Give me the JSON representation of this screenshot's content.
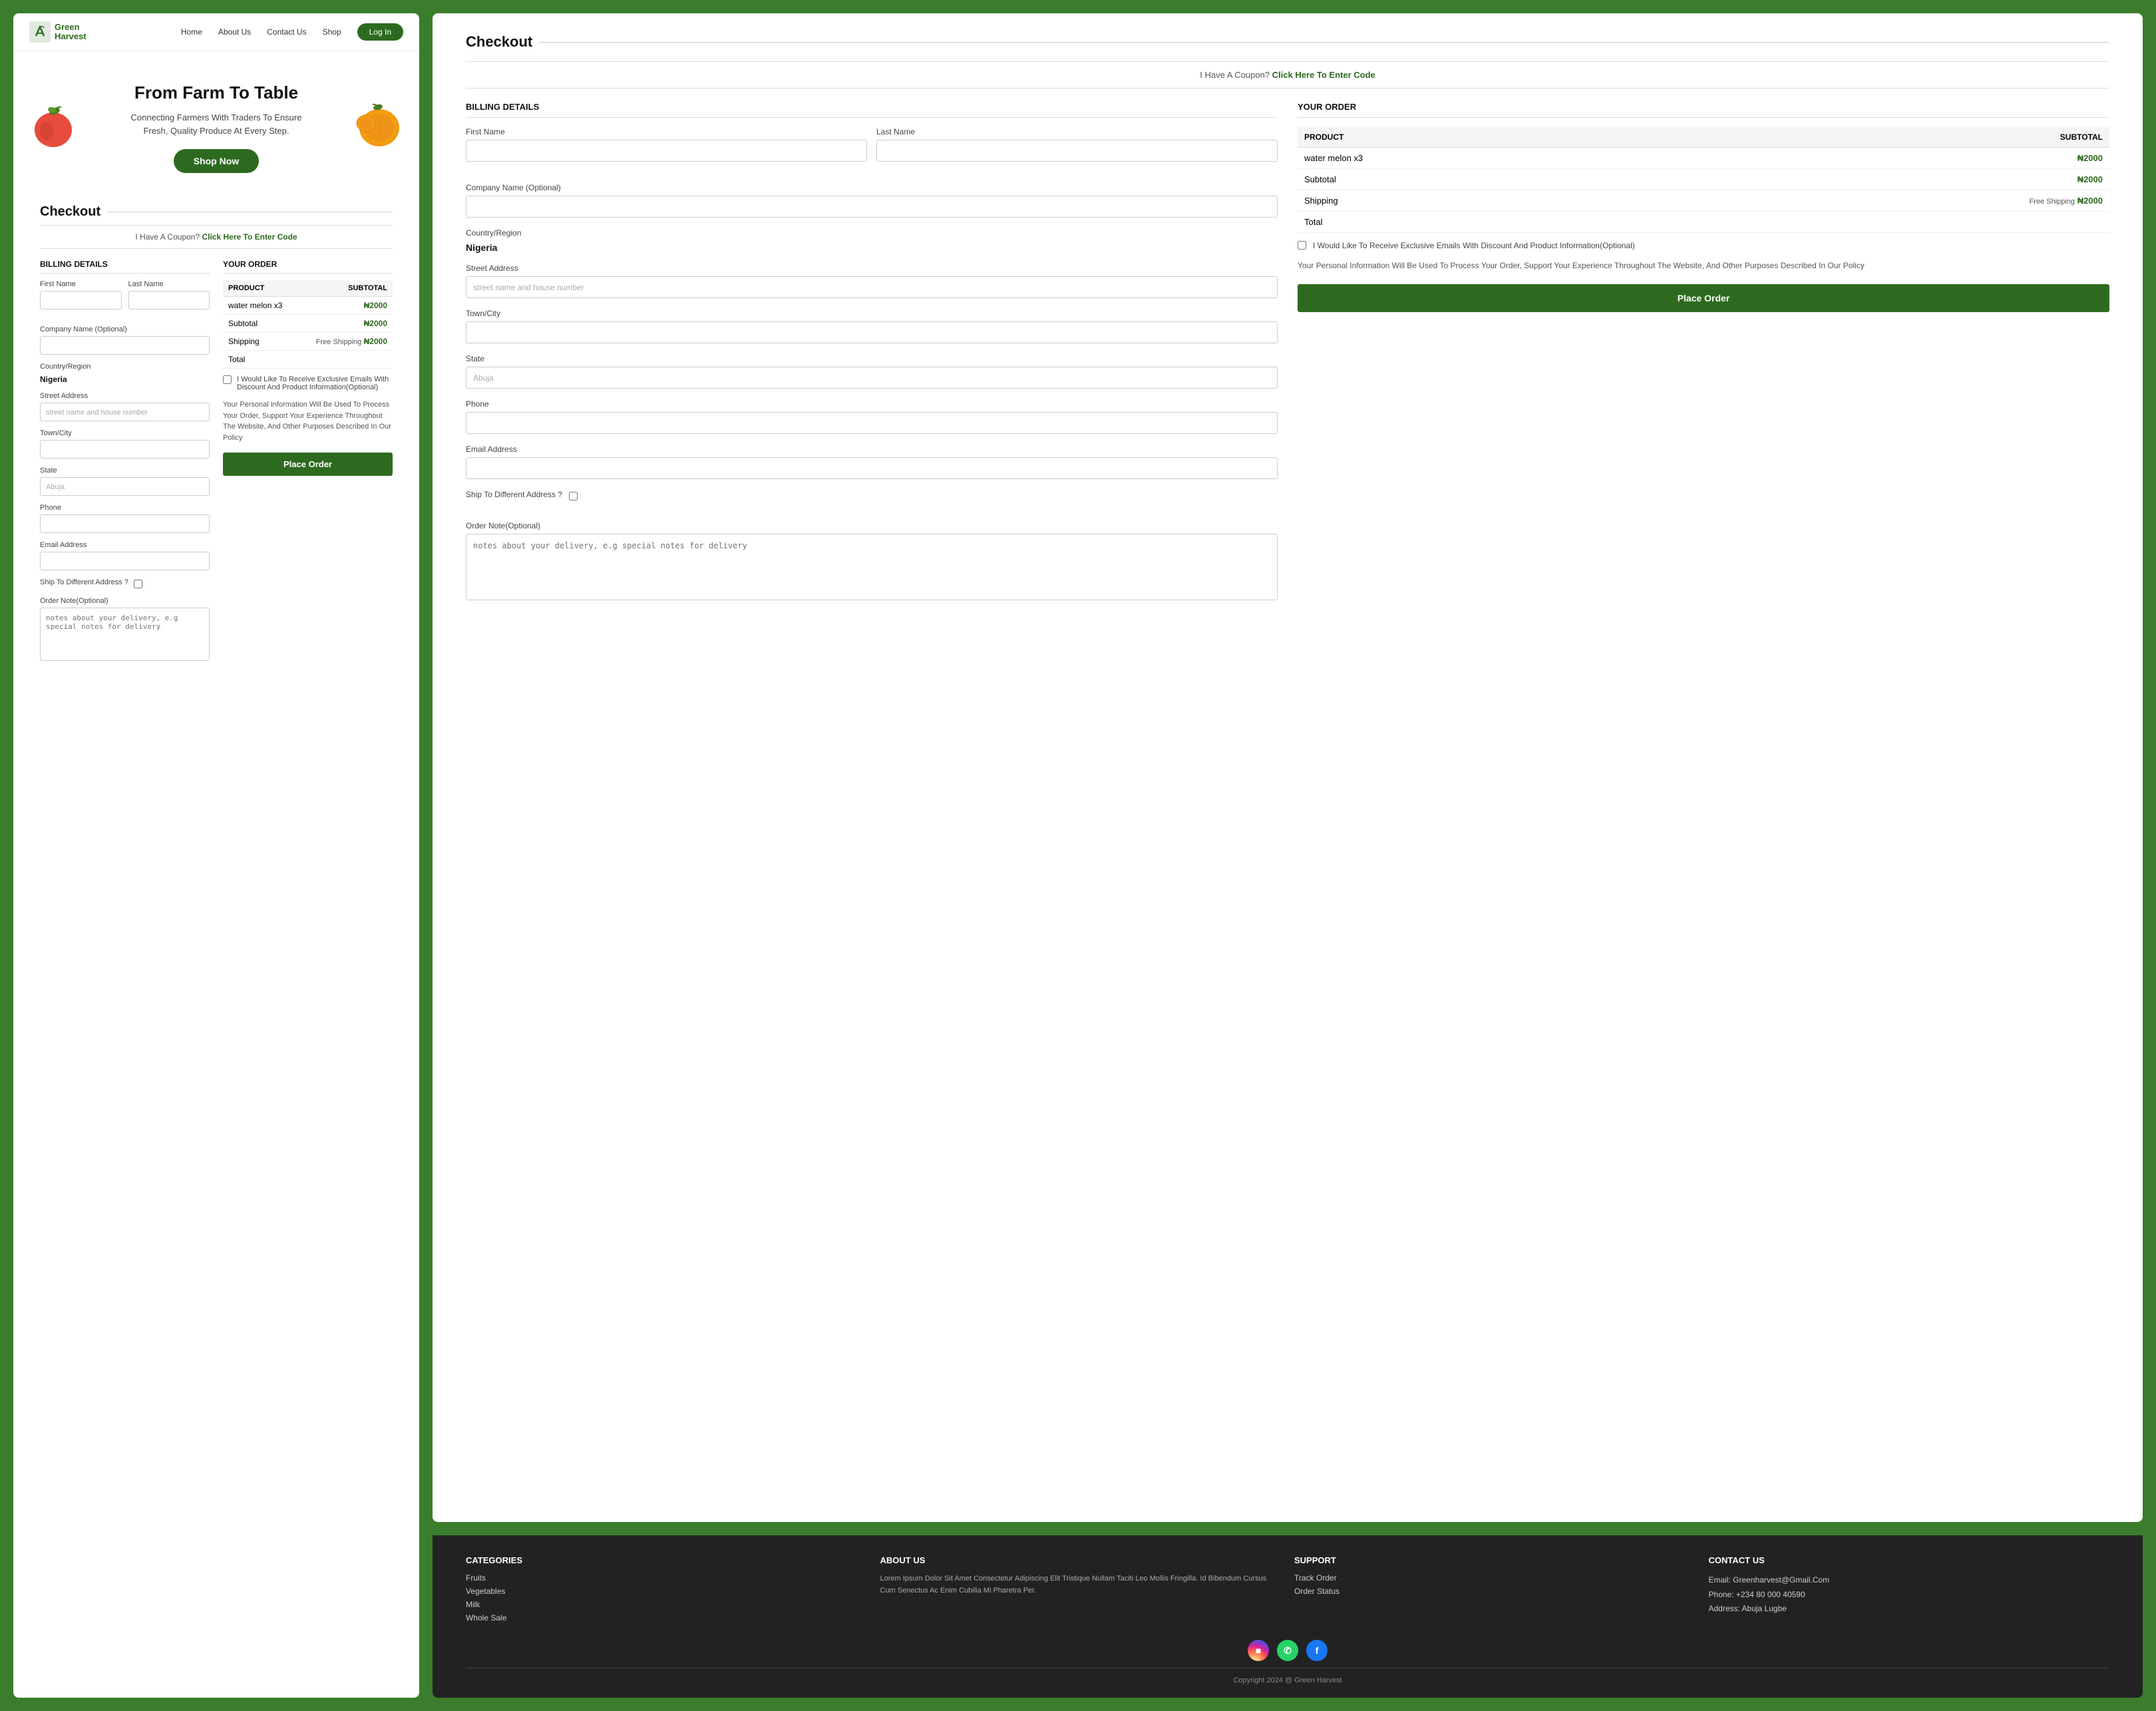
{
  "nav": {
    "logo_text_line1": "Green",
    "logo_text_line2": "Harvest",
    "links": [
      "Home",
      "About Us",
      "Contact Us",
      "Shop"
    ],
    "login_label": "Log In"
  },
  "hero": {
    "title": "From Farm To Table",
    "subtitle": "Connecting Farmers With Traders To Ensure\nFresh, Quality Produce At Every Step.",
    "shop_now": "Shop Now"
  },
  "checkout_left": {
    "title": "Checkout",
    "coupon_text": "I Have A Coupon?",
    "coupon_link": "Click Here To Enter Code",
    "billing_label": "BILLING DETAILS",
    "order_label": "YOUR ORDER",
    "first_name_label": "First Name",
    "last_name_label": "Last Name",
    "company_label": "Company Name (Optional)",
    "country_label": "Country/Region",
    "country_value": "Nigeria",
    "street_label": "Street Address",
    "street_placeholder": "street name and house number",
    "town_label": "Town/City",
    "state_label": "State",
    "state_value": "Abuja",
    "phone_label": "Phone",
    "email_label": "Email Address",
    "ship_label": "Ship To Different Address ?",
    "order_note_label": "Order Note(Optional)",
    "order_note_placeholder": "notes about your delivery, e.g special notes for delivery",
    "product_col": "PRODUCT",
    "subtotal_col": "SUBTOTAL",
    "product_row": "water melon x3",
    "product_price": "₦2000",
    "subtotal_row": "Subtotal",
    "subtotal_price": "₦2000",
    "shipping_row": "Shipping",
    "free_shipping": "Free Shipping",
    "shipping_price": "₦2000",
    "total_row": "Total",
    "email_checkbox": "I Would Like To Receive Exclusive Emails With Discount And Product Information(Optional)",
    "privacy_text": "Your Personal Information Will Be Used To Process Your Order, Support Your Experience Throughout The Website, And Other Purposes Described In Our Policy",
    "place_order": "Place Order"
  },
  "checkout_right": {
    "title": "Checkout",
    "coupon_text": "I Have A Coupon?",
    "coupon_link": "Click Here To Enter Code",
    "billing_label": "BILLING DETAILS",
    "order_label": "YOUR ORDER",
    "first_name_label": "First Name",
    "last_name_label": "Last Name",
    "company_label": "Company Name (Optional)",
    "country_label": "Country/Region",
    "country_value": "Nigeria",
    "street_label": "Street Address",
    "street_placeholder": "street name and house number",
    "town_label": "Town/City",
    "state_label": "State",
    "state_value": "Abuja",
    "phone_label": "Phone",
    "email_label": "Email Address",
    "ship_label": "Ship To Different Address ?",
    "order_note_label": "Order Note(Optional)",
    "order_note_placeholder": "notes about your delivery, e.g special notes for delivery",
    "product_col": "PRODUCT",
    "subtotal_col": "SUBTOTAL",
    "product_row": "water melon x3",
    "product_price": "₦2000",
    "subtotal_row": "Subtotal",
    "subtotal_price": "₦2000",
    "shipping_row": "Shipping",
    "free_shipping": "Free Shipping",
    "shipping_price": "₦2000",
    "total_row": "Total",
    "email_checkbox": "I Would Like To Receive Exclusive Emails With Discount And Product Information(Optional)",
    "privacy_text": "Your Personal Information Will Be Used To Process Your Order, Support Your Experience Throughout The Website, And Other Purposes Described In Our Policy",
    "place_order": "Place Order"
  },
  "footer": {
    "categories_title": "CATEGORIES",
    "categories": [
      "Fruits",
      "Vegetables",
      "Milk",
      "Whole Sale"
    ],
    "about_title": "ABOUT US",
    "about_text": "Lorem Ipsum Dolor Sit Amet Consectetur Adipiscing Elit Tristique Nullam Taciti Leo Mollis Fringilla. Id Bibendum Cursus Cum Senectus Ac Enim Cubilia Mi Pharetra Per.",
    "support_title": "SUPPORT",
    "support_links": [
      "Track Order",
      "Order Status"
    ],
    "contact_title": "CONTACT US",
    "contact_email": "Email: Greenharvest@Gmail.Com",
    "contact_phone": "Phone: +234 80 000 40590",
    "contact_address": "Address: Abuja Lugbe",
    "copyright": "Copyright  2024  @ Green Harvest"
  }
}
